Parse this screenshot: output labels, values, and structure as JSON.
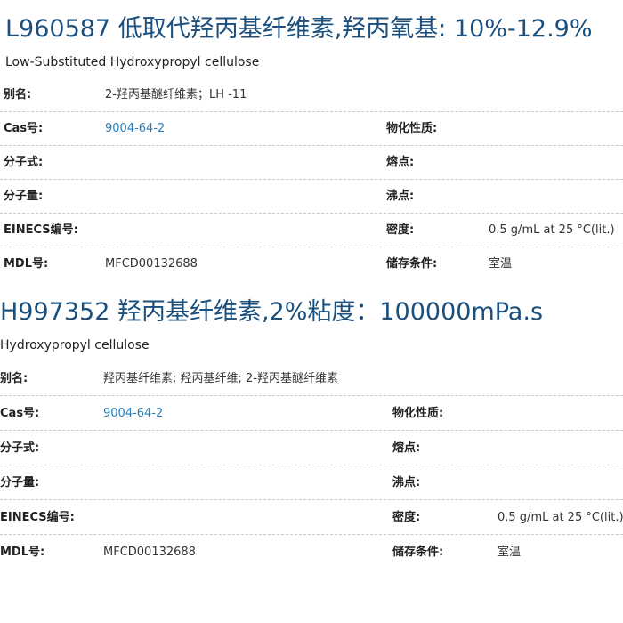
{
  "products": [
    {
      "title": "L960587 低取代羟丙基纤维素,羟丙氧基: 10%-12.9%",
      "subtitle": "Low-Substituted Hydroxypropyl cellulose",
      "labels": {
        "alias": "别名:",
        "cas": "Cas号:",
        "formula": "分子式:",
        "weight": "分子量:",
        "einecs": "EINECS编号:",
        "mdl": "MDL号:",
        "properties": "物化性质:",
        "melting": "熔点:",
        "boiling": "沸点:",
        "density": "密度:",
        "storage": "储存条件:"
      },
      "alias": "2-羟丙基醚纤维素；LH -11",
      "cas": "9004-64-2",
      "formula": "",
      "weight": "",
      "einecs": "",
      "mdl": "MFCD00132688",
      "properties": "",
      "melting": "",
      "boiling": "",
      "density": "0.5 g/mL at 25 °C(lit.)",
      "storage": "室温"
    },
    {
      "title": "H997352 羟丙基纤维素,2%粘度：100000mPa.s",
      "subtitle": "Hydroxypropyl cellulose",
      "labels": {
        "alias": "别名:",
        "cas": "Cas号:",
        "formula": "分子式:",
        "weight": "分子量:",
        "einecs": "EINECS编号:",
        "mdl": "MDL号:",
        "properties": "物化性质:",
        "melting": "熔点:",
        "boiling": "沸点:",
        "density": "密度:",
        "storage": "储存条件:"
      },
      "alias": "羟丙基纤维素; 羟丙基纤维; 2-羟丙基醚纤维素",
      "cas": "9004-64-2",
      "formula": "",
      "weight": "",
      "einecs": "",
      "mdl": "MFCD00132688",
      "properties": "",
      "melting": "",
      "boiling": "",
      "density": "0.5 g/mL at 25 °C(lit.)",
      "storage": "室温"
    }
  ]
}
